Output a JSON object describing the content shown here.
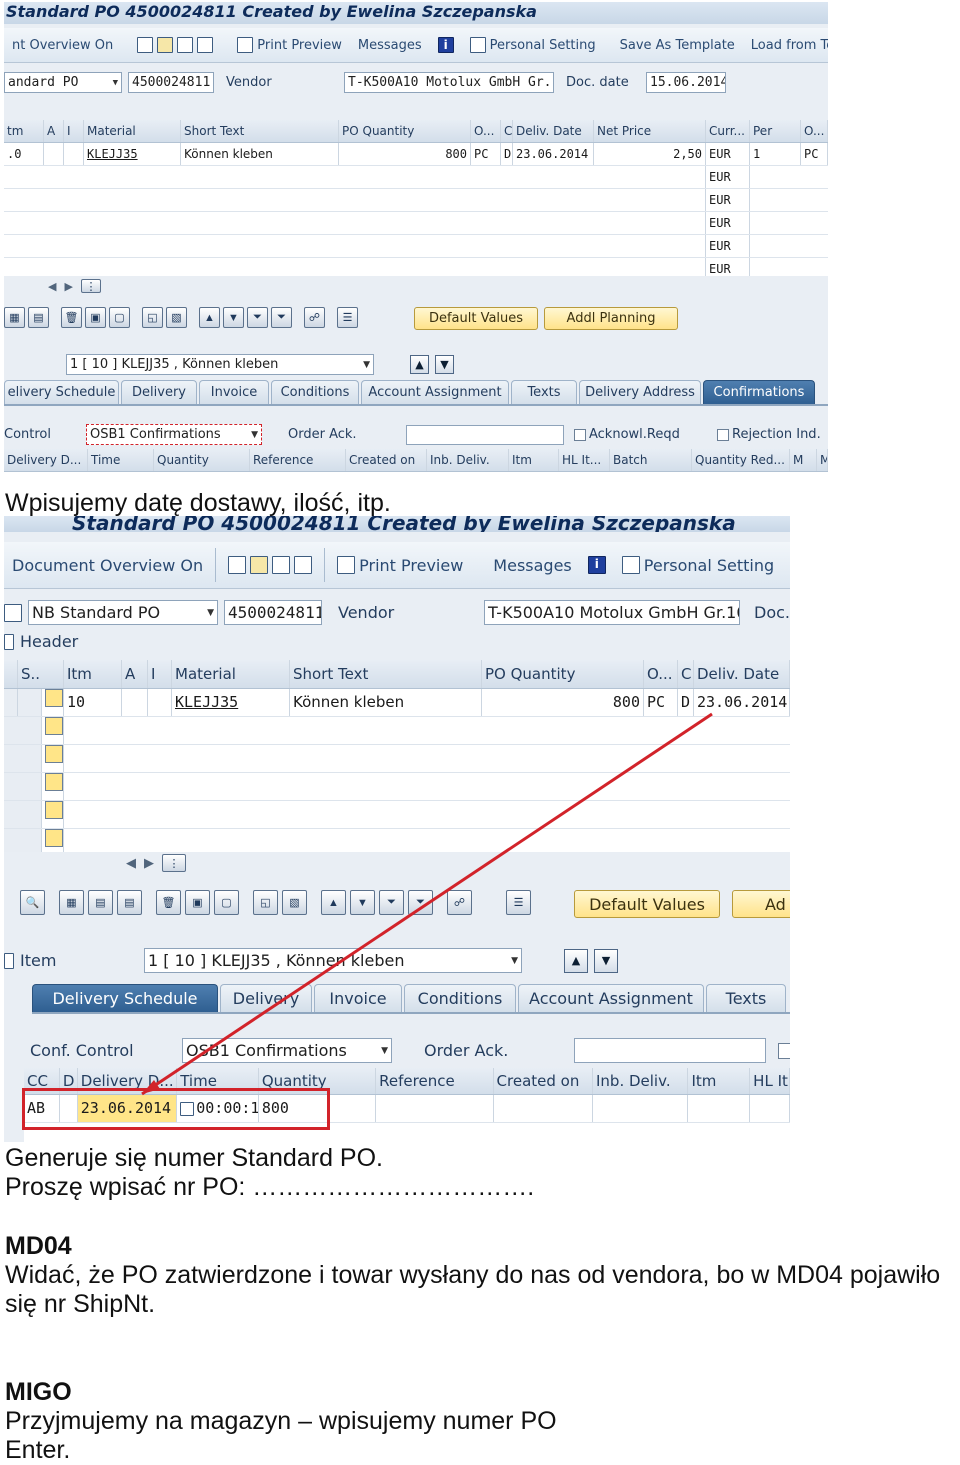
{
  "screenshot1": {
    "title": "Standard PO 4500024811 Created by Ewelina Szczepanska",
    "toolbar": [
      "nt Overview On",
      "Print Preview",
      "Messages",
      "Personal Setting",
      "Save As Template",
      "Load from Tem"
    ],
    "header": {
      "po_type": "andard PO",
      "po_number": "4500024811",
      "vendor_label": "Vendor",
      "vendor": "T-K500A10 Motolux GmbH Gr.10",
      "doc_date_label": "Doc. date",
      "doc_date": "15.06.2014"
    },
    "item_columns": [
      "tm",
      "A",
      "I",
      "Material",
      "Short Text",
      "PO Quantity",
      "O...",
      "C",
      "Deliv. Date",
      "Net Price",
      "Curr...",
      "Per",
      "O..."
    ],
    "item_row": {
      "itm": ".0",
      "material": "KLEJJ35",
      "short_text": "Können kleben",
      "qty": "800",
      "unit": "PC",
      "c": "D",
      "deliv_date": "23.06.2014",
      "net_price": "2,50",
      "curr": "EUR",
      "per": "1",
      "order_unit": "PC"
    },
    "empty_currency": [
      "EUR",
      "EUR",
      "EUR",
      "EUR",
      "EUR"
    ],
    "default_values_btn": "Default Values",
    "addl_planning_btn": "Addl Planning",
    "item_selector": "1 [ 10 ] KLEJJ35 , Können kleben",
    "tabs": [
      "elivery Schedule",
      "Delivery",
      "Invoice",
      "Conditions",
      "Account Assignment",
      "Texts",
      "Delivery Address",
      "Confirmations"
    ],
    "control_label": "Control",
    "conf_control": "OSB1 Confirmations",
    "order_ack_label": "Order Ack.",
    "acknowl_label": "Acknowl.Reqd",
    "rejection_label": "Rejection Ind.",
    "conf_columns": [
      "Delivery D...",
      "Time",
      "Quantity",
      "Reference",
      "Created on",
      "Inb. Deliv.",
      "Itm",
      "HL It...",
      "Batch",
      "Quantity Red...",
      "M",
      "M"
    ]
  },
  "caption1": "Wpisujemy datę dostawy, ilość, itp.",
  "screenshot2": {
    "title": "Standard PO 4500024811 Created by Ewelina Szczepanska",
    "toolbar": [
      "Document Overview On",
      "Print Preview",
      "Messages",
      "Personal Setting"
    ],
    "header": {
      "po_type": "NB Standard PO",
      "po_number": "4500024811",
      "vendor_label": "Vendor",
      "vendor": "T-K500A10 Motolux GmbH Gr.10",
      "doc_label": "Doc."
    },
    "header_section": "Header",
    "item_columns": [
      "S..",
      "Itm",
      "A",
      "I",
      "Material",
      "Short Text",
      "PO Quantity",
      "O...",
      "C",
      "Deliv. Date"
    ],
    "item_row": {
      "itm": "10",
      "material": "KLEJJ35",
      "short_text": "Können kleben",
      "qty": "800",
      "unit": "PC",
      "c": "D",
      "deliv_date": "23.06.2014"
    },
    "default_values_btn": "Default Values",
    "addl_btn_partial": "Ad",
    "item_label": "Item",
    "item_selector": "1 [ 10 ] KLEJJ35 , Können kleben",
    "tabs": [
      "Delivery Schedule",
      "Delivery",
      "Invoice",
      "Conditions",
      "Account Assignment",
      "Texts"
    ],
    "conf_control_label": "Conf. Control",
    "conf_control": "OSB1 Confirmations",
    "order_ack_label": "Order Ack.",
    "conf_columns": [
      "CC",
      "D",
      "Delivery D...",
      "Time",
      "Quantity",
      "Reference",
      "Created on",
      "Inb. Deliv.",
      "Itm",
      "HL It"
    ],
    "conf_row": {
      "cc": "AB",
      "delivery_date": "23.06.2014",
      "time": "00:00:11",
      "quantity": "800"
    },
    "highlight_color": "#d2232a"
  },
  "text_lines": {
    "generates": "Generuje się numer Standard PO.",
    "enter_po": "Proszę wpisać nr PO: …………………………….",
    "md04_heading": "MD04",
    "md04_line1": "Widać, że PO zatwierdzone i towar wysłany do nas od vendora, bo w MD04 pojawiło",
    "md04_line2": "się nr ShipNt.",
    "migo_heading": "MIGO",
    "migo_line1": "Przyjmujemy na magazyn – wpisujemy numer PO",
    "migo_line2": "Enter."
  }
}
